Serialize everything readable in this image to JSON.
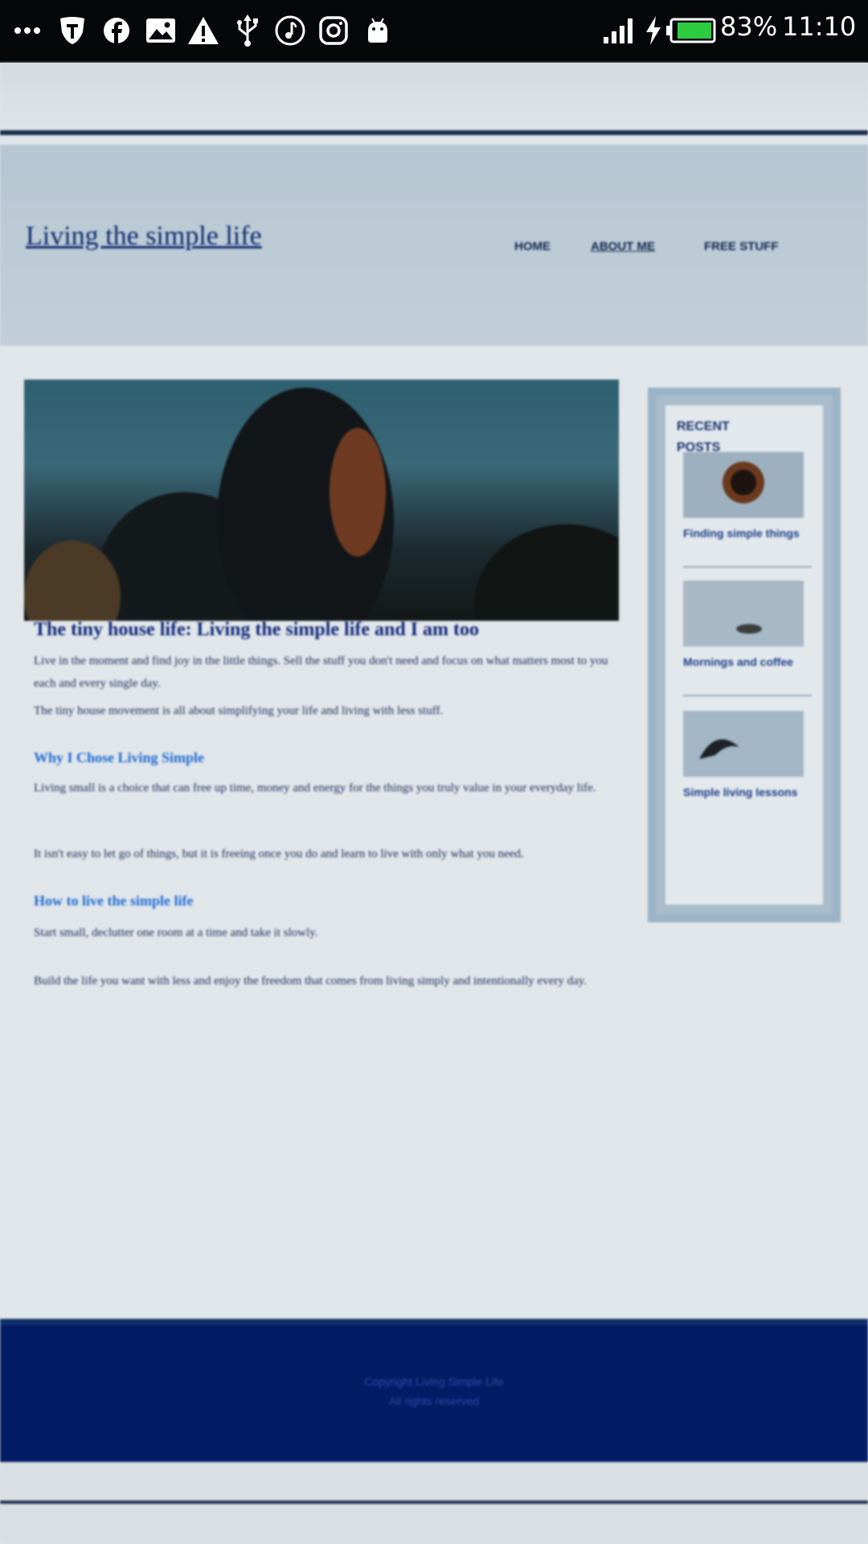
{
  "status_bar": {
    "battery": "83%",
    "time": "11:10",
    "left_icons": [
      "more-dots-icon",
      "shield-icon",
      "facebook-icon",
      "image-icon",
      "warning-icon",
      "usb-icon",
      "music-icon",
      "instagram-icon",
      "android-icon"
    ],
    "right_icons": [
      "signal-icon",
      "charging-bolt-icon",
      "battery-icon"
    ],
    "colors": {
      "bar": "#060709",
      "battery_fill": "#2ecc40"
    }
  },
  "website": {
    "site_title": "Living the simple life",
    "nav": [
      "HOME",
      "ABOUT ME",
      "FREE STUFF"
    ],
    "article": {
      "title": "The tiny house life: Living the simple life and I am too",
      "paragraphs": [
        "Live in the moment and find joy in the little things. Sell the stuff you don't need and focus on what matters most to you each and every single day.",
        "The tiny house movement is all about simplifying your life and living with less stuff.",
        "Living small is a choice that can free up time, money and energy for the things you truly value in your everyday life.",
        "It isn't easy to let go of things, but it is freeing once you do and learn to live with only what you need.",
        "Start small, declutter one room at a time and take it slowly.",
        "Build the life you want with less and enjoy the freedom that comes from living simply and intentionally every day."
      ],
      "subheadings": [
        "Why I Chose Living Simple",
        "How to live the simple life"
      ]
    },
    "sidebar": {
      "title": "RECENT POSTS",
      "posts": [
        "Finding simple things",
        "Mornings and coffee",
        "Simple living lessons"
      ]
    },
    "footer": [
      "Copyright Living Simple Life",
      "All rights reserved"
    ],
    "colors": {
      "header": "#b6c6d2",
      "footer": "#041b66",
      "link": "#1f6ad3",
      "title": "#0d2a70"
    }
  }
}
